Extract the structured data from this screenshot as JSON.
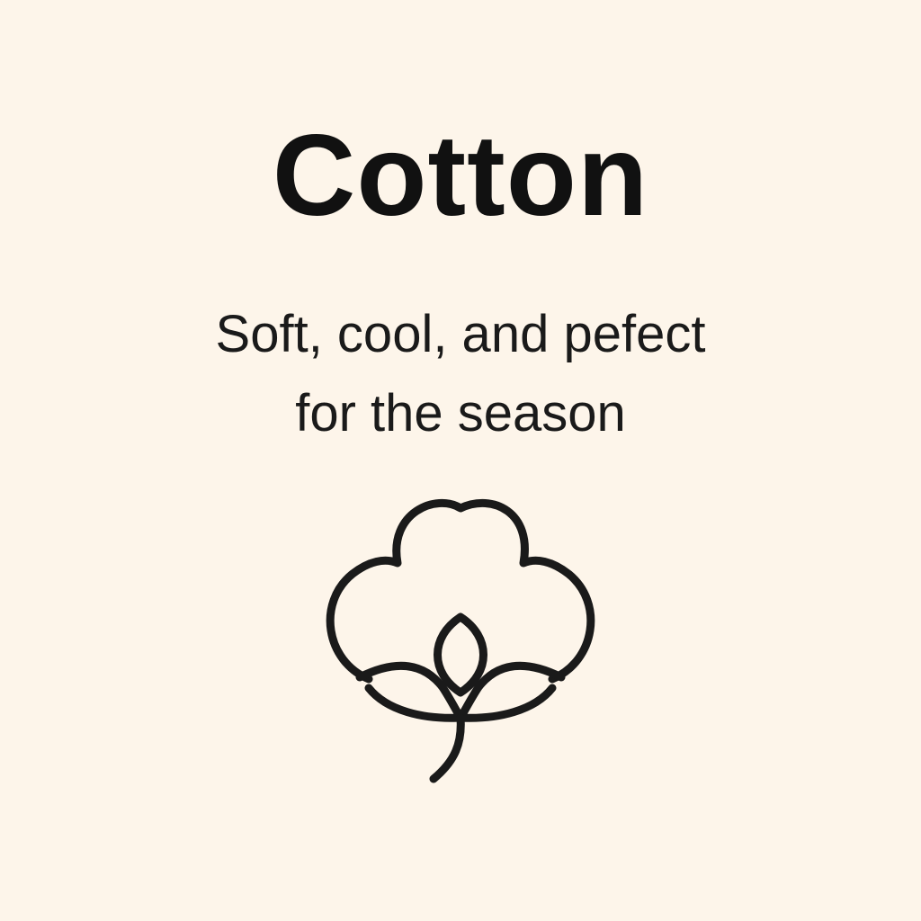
{
  "poster": {
    "title": "Cotton",
    "tagline_line1": "Soft, cool, and pefect",
    "tagline_line2": "for the season",
    "icon": "cotton-boll-icon",
    "colors": {
      "background": "#fdf5ea",
      "text": "#111111",
      "icon_stroke": "#1a1a1a"
    }
  }
}
